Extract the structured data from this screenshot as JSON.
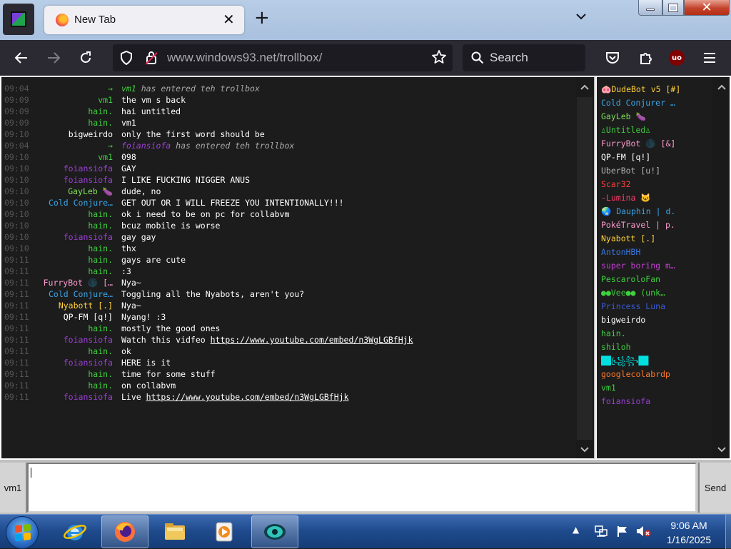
{
  "browser": {
    "tab_title": "New Tab",
    "tab_close": "✕",
    "new_tab": "+",
    "tab_list": "⌄",
    "url_host": "www.windows93.net",
    "url_path": "/trollbox/",
    "search_placeholder": "Search",
    "ublock_label": "uo"
  },
  "chat": {
    "messages": [
      {
        "time": "09:04",
        "nick": "→",
        "nick_color": "#3fd23f",
        "text": "",
        "sys_nick": "vm1",
        "sys_nick_color": "#3fd23f",
        "sys_text": " has entered teh trollbox",
        "type": "system"
      },
      {
        "time": "09:09",
        "nick": "vm1",
        "nick_color": "#3fd23f",
        "text": "the vm s back"
      },
      {
        "time": "09:09",
        "nick": "hain.",
        "nick_color": "#3fd23f",
        "text": "hai untitled"
      },
      {
        "time": "09:09",
        "nick": "hain.",
        "nick_color": "#3fd23f",
        "text": "vm1"
      },
      {
        "time": "09:10",
        "nick": "bigweirdo",
        "nick_color": "#ffffff",
        "text": "only the first word should be"
      },
      {
        "time": "09:04",
        "nick": "→",
        "nick_color": "#3fd23f",
        "text": "",
        "sys_nick": "foiansiofa",
        "sys_nick_color": "#9b3fd6",
        "sys_text": " has entered teh trollbox",
        "type": "system"
      },
      {
        "time": "09:10",
        "nick": "vm1",
        "nick_color": "#3fd23f",
        "text": "098"
      },
      {
        "time": "09:10",
        "nick": "foiansiofa",
        "nick_color": "#9b3fd6",
        "text": "GAY"
      },
      {
        "time": "09:10",
        "nick": "foiansiofa",
        "nick_color": "#9b3fd6",
        "text": "I LIKE FUCKING NIGGER ANUS"
      },
      {
        "time": "09:10",
        "nick": "GayLeb 🍆",
        "nick_color": "#7fe05a",
        "text": "dude, no"
      },
      {
        "time": "09:10",
        "nick": "Cold Conjure…",
        "nick_color": "#3aa6e8",
        "text": "GET OUT OR I WILL FREEZE YOU INTENTIONALLY!!!"
      },
      {
        "time": "09:10",
        "nick": "hain.",
        "nick_color": "#3fd23f",
        "text": "ok i need to be on pc for collabvm"
      },
      {
        "time": "09:10",
        "nick": "hain.",
        "nick_color": "#3fd23f",
        "text": "bcuz mobile is worse"
      },
      {
        "time": "09:10",
        "nick": "foiansiofa",
        "nick_color": "#9b3fd6",
        "text": "gay gay"
      },
      {
        "time": "09:10",
        "nick": "hain.",
        "nick_color": "#3fd23f",
        "text": "thx"
      },
      {
        "time": "09:11",
        "nick": "hain.",
        "nick_color": "#3fd23f",
        "text": "gays are cute"
      },
      {
        "time": "09:11",
        "nick": "hain.",
        "nick_color": "#3fd23f",
        "text": ":3"
      },
      {
        "time": "09:11",
        "nick": "FurryBot 🌑 […",
        "nick_color": "#ff9bd0",
        "text": "Nya~"
      },
      {
        "time": "09:11",
        "nick": "Cold Conjure…",
        "nick_color": "#3aa6e8",
        "text": "Toggling all the Nyabots, aren't you?"
      },
      {
        "time": "09:11",
        "nick": "Nyabott [.]",
        "nick_color": "#ffd23a",
        "text": "Nya~"
      },
      {
        "time": "09:11",
        "nick": "QP-FM [q!]",
        "nick_color": "#ffffff",
        "text": "Nyang! :3"
      },
      {
        "time": "09:11",
        "nick": "hain.",
        "nick_color": "#3fd23f",
        "text": "mostly the good ones"
      },
      {
        "time": "09:11",
        "nick": "foiansiofa",
        "nick_color": "#9b3fd6",
        "text": "Watch this vidfeo ",
        "link": "https://www.youtube.com/embed/n3WgLGBfHjk"
      },
      {
        "time": "09:11",
        "nick": "hain.",
        "nick_color": "#3fd23f",
        "text": "ok"
      },
      {
        "time": "09:11",
        "nick": "foiansiofa",
        "nick_color": "#9b3fd6",
        "text": "HERE is it"
      },
      {
        "time": "09:11",
        "nick": "hain.",
        "nick_color": "#3fd23f",
        "text": "time for some stuff"
      },
      {
        "time": "09:11",
        "nick": "hain.",
        "nick_color": "#3fd23f",
        "text": "on collabvm"
      },
      {
        "time": "09:11",
        "nick": "foiansiofa",
        "nick_color": "#9b3fd6",
        "text": "Live ",
        "link": "https://www.youtube.com/embed/n3WgLGBfHjk"
      }
    ],
    "users": [
      {
        "name": "🐽DudeBot v5 [#]",
        "color": "#ffd23a"
      },
      {
        "name": "Cold Conjurer …",
        "color": "#3aa6e8"
      },
      {
        "name": "GayLeb 🍆",
        "color": "#7fe05a"
      },
      {
        "name": "♙Untitled♙",
        "color": "#3fd23f"
      },
      {
        "name": "FurryBot 🌑 [&]",
        "color": "#ff9bd0"
      },
      {
        "name": "QP-FM [q!]",
        "color": "#ffffff"
      },
      {
        "name": "UberBot [u!]",
        "color": "#b4b4b4"
      },
      {
        "name": "Scar32",
        "color": "#ff4040"
      },
      {
        "name": "-Lumina 🐱",
        "color": "#ff3f6a"
      },
      {
        "name": "🌏 Dauphin | d.",
        "color": "#3aa6e8"
      },
      {
        "name": "PokéTravel | p.",
        "color": "#ff9bd0"
      },
      {
        "name": "Nyabott [.]",
        "color": "#ffd23a"
      },
      {
        "name": "AntonHBH",
        "color": "#3a7ae8"
      },
      {
        "name": "super boring m…",
        "color": "#c43fd6"
      },
      {
        "name": "PescaroloFan",
        "color": "#3fd23f"
      },
      {
        "name": "●●Vee●● (unk…",
        "color": "#3fd23f"
      },
      {
        "name": "Princess Luna",
        "color": "#3a5ad8"
      },
      {
        "name": "bigweirdo",
        "color": "#ffffff"
      },
      {
        "name": "hain.",
        "color": "#3fd23f"
      },
      {
        "name": "shiloh",
        "color": "#3fd23f"
      },
      {
        "name": "██꧁ꦿ꧂██",
        "color": "#00e0e0"
      },
      {
        "name": "googlecolabrdp",
        "color": "#ff7a2a"
      },
      {
        "name": "vm1",
        "color": "#3fd23f"
      },
      {
        "name": "foiansiofa",
        "color": "#9b3fd6"
      }
    ],
    "nick_button": "vm1",
    "send_button": "Send"
  },
  "taskbar": {
    "time": "9:06 AM",
    "date": "1/16/2025"
  },
  "colors": {
    "chat_bg": "#1c1c1c",
    "timestamp": "#555555"
  }
}
